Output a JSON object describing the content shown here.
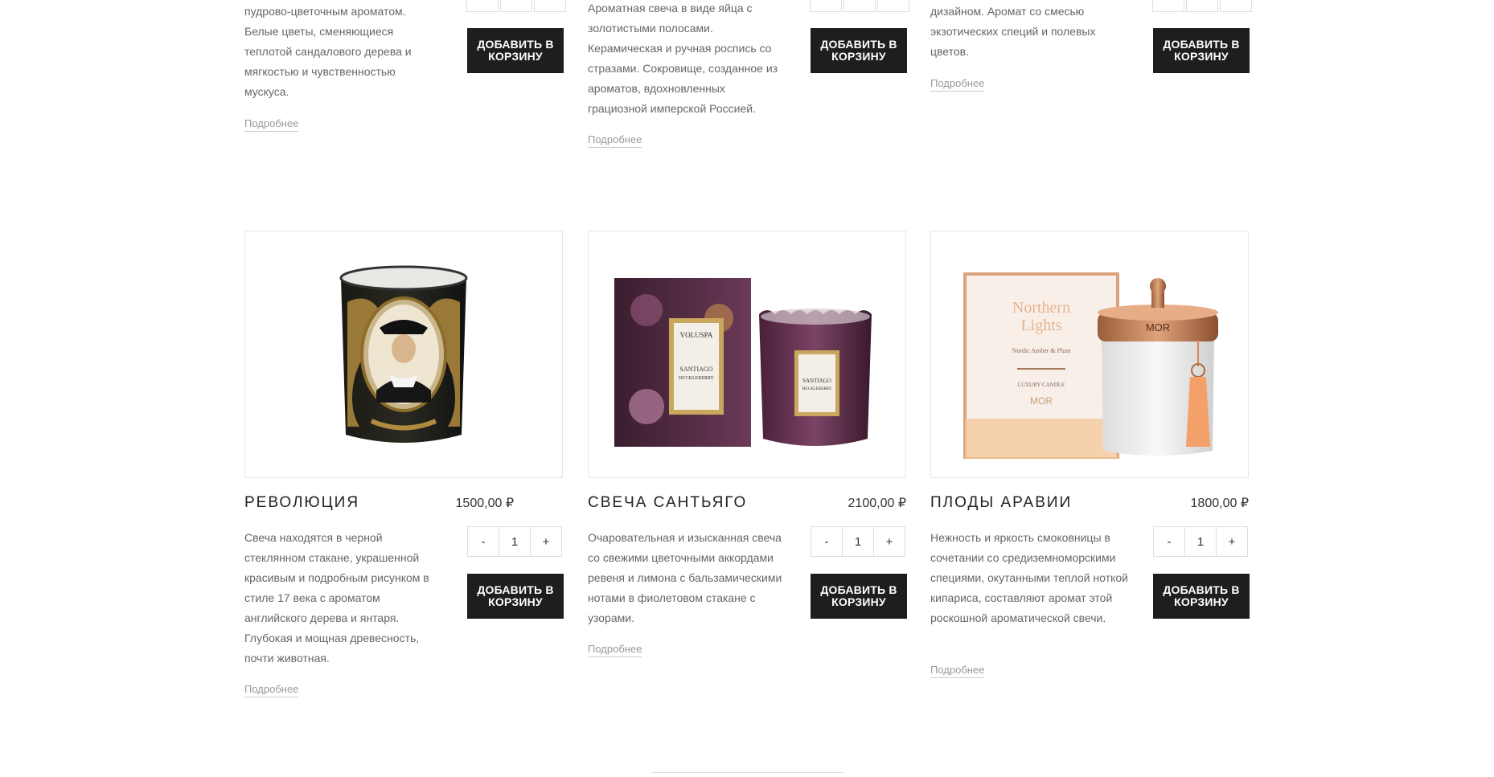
{
  "top_row": [
    {
      "description": "пудрово-цветочным ароматом. Белые цветы, сменяющиеся теплотой сандалового дерева и мягкостью и чувственностью мускуса.",
      "more_link": "Подробнее",
      "add_to_cart": "Добавить в корзину"
    },
    {
      "description": "Ароматная свеча в виде яйца с золотистыми полосами. Керамическая и ручная роспись со стразами. Сокровище, созданное из ароматов, вдохновленных грациозной имперской Россией.",
      "more_link": "Подробнее",
      "add_to_cart": "Добавить в корзину"
    },
    {
      "description": "дизайном. Аромат со смесью экзотических специй и полевых цветов.",
      "more_link": "Подробнее",
      "add_to_cart": "Добавить в корзину"
    }
  ],
  "products": [
    {
      "title": "Революция",
      "price": "1500,00 ₽",
      "description": "Свеча находятся в черной стеклянном стакане, украшенной красивым и подробным рисунком в стиле 17 века с ароматом английского дерева и янтаря. Глубокая и мощная древесность, почти животная.",
      "qty_minus": "-",
      "qty_value": "1",
      "qty_plus": "+",
      "add_to_cart": "Добавить в корзину",
      "more_link": "Подробнее",
      "image_icon": "black-decorated-candle-jar"
    },
    {
      "title": "Свеча Сантьяго",
      "price": "2100,00 ₽",
      "description": "Очаровательная и изысканная свеча со свежими цветочными аккордами ревеня и лимона с бальзамическими нотами в фиолетовом стакане с узорами.",
      "qty_minus": "-",
      "qty_value": "1",
      "qty_plus": "+",
      "add_to_cart": "Добавить в корзину",
      "more_link": "Подробнее",
      "image_icon": "purple-candle-with-box",
      "image_text": {
        "brand": "VOLUSPA",
        "label_line1": "SANTIAGO",
        "label_line2": "HUCKLEBERRY"
      }
    },
    {
      "title": "Плоды Аравии",
      "price": "1800,00 ₽",
      "description": "Нежность и яркость смоковницы в сочетании со средиземноморскими специями, окутанными теплой ноткой кипариса, составляют аромат этой роскошной ароматической свечи.",
      "qty_minus": "-",
      "qty_value": "1",
      "qty_plus": "+",
      "add_to_cart": "Добавить в корзину",
      "more_link": "Подробнее",
      "image_icon": "white-candle-with-copper-lid",
      "image_text": {
        "box_title_1": "Northern",
        "box_title_2": "Lights",
        "box_sub": "Nordic Amber & Plum",
        "box_type": "LUXURY CANDLE",
        "brand": "MOR"
      }
    }
  ],
  "colors": {
    "button_bg": "#1e1e1e",
    "button_text": "#ffffff",
    "border": "#e6e6e6",
    "text_muted": "#666666"
  }
}
